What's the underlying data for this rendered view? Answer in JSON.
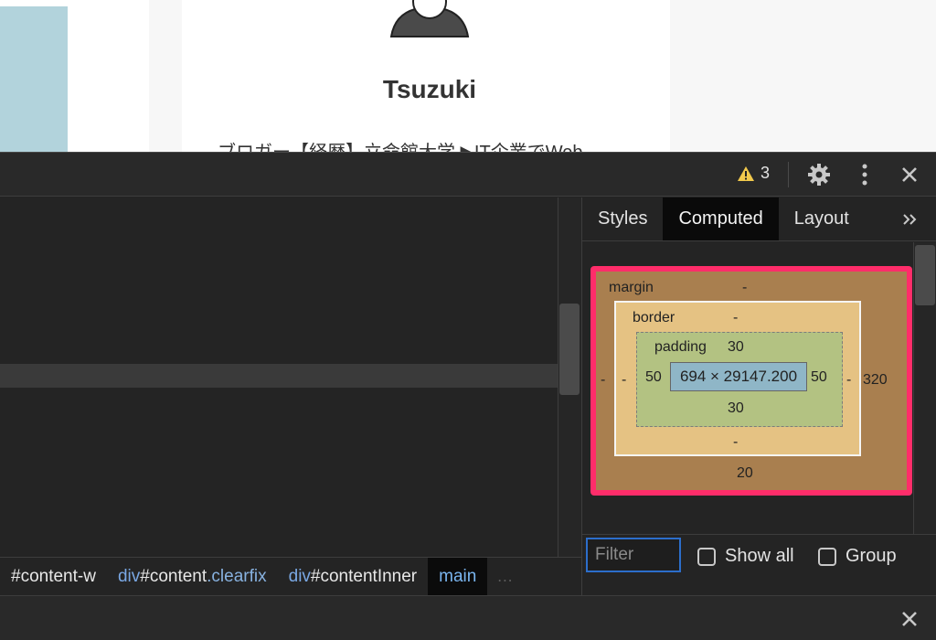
{
  "webpage": {
    "author_name": "Tsuzuki",
    "bio": "ブロガー【経歴】立命館大学 ▶IT企業でWeb"
  },
  "topbar": {
    "warning_count": "3",
    "warning_icon": "warning-triangle-icon",
    "settings_icon": "gear-icon",
    "menu_icon": "kebab-menu-icon",
    "close_icon": "close-icon"
  },
  "breadcrumb": [
    {
      "tag": "",
      "id": "#content-w",
      "cls": ""
    },
    {
      "tag": "div",
      "id": "#content",
      "cls": ".clearfix"
    },
    {
      "tag": "div",
      "id": "#contentInner",
      "cls": ""
    },
    {
      "tag": "main",
      "id": "",
      "cls": ""
    }
  ],
  "breadcrumb_more": "…",
  "sidebar": {
    "tabs": [
      "Styles",
      "Computed",
      "Layout"
    ],
    "active_tab": "Computed",
    "more_icon": "chevron-double-right-icon"
  },
  "box_model": {
    "margin_label": "margin",
    "margin_top": "-",
    "margin_left": "-",
    "margin_right": "320",
    "margin_bottom": "20",
    "border_label": "border",
    "border_top": "-",
    "border_left": "-",
    "border_right": "-",
    "border_bottom": "-",
    "padding_label": "padding",
    "padding_top": "30",
    "padding_left": "50",
    "padding_right": "50",
    "padding_bottom": "30",
    "content_size": "694 × 29147.200"
  },
  "filter": {
    "placeholder": "Filter",
    "show_all_label": "Show all",
    "group_label": "Group"
  },
  "colors": {
    "margin": "#a97f4f",
    "border": "#e5c283",
    "padding": "#b3c282",
    "content": "#8fb6c7",
    "highlight": "#ff2d6a"
  }
}
